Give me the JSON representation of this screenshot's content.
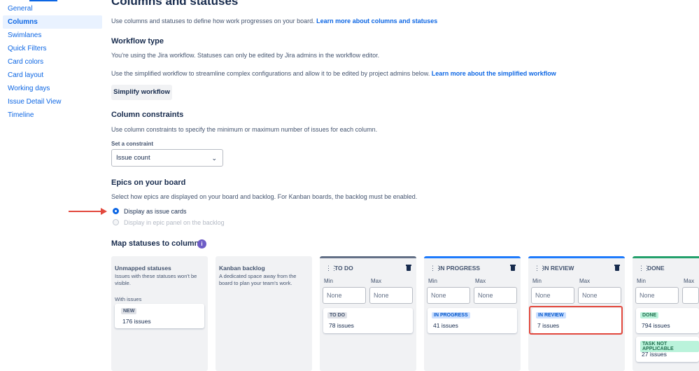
{
  "sidebar": {
    "items": [
      {
        "label": "General"
      },
      {
        "label": "Columns"
      },
      {
        "label": "Swimlanes"
      },
      {
        "label": "Quick Filters"
      },
      {
        "label": "Card colors"
      },
      {
        "label": "Card layout"
      },
      {
        "label": "Working days"
      },
      {
        "label": "Issue Detail View"
      },
      {
        "label": "Timeline"
      }
    ]
  },
  "header": {
    "title": "Columns and statuses",
    "intro": "Use columns and statuses to define how work progresses on your board.",
    "intro_link": "Learn more about columns and statuses"
  },
  "workflow": {
    "title": "Workflow type",
    "text1": "You're using the Jira workflow. Statuses can only be edited by Jira admins in the workflow editor.",
    "text2": "Use the simplified workflow to streamline complex configurations and allow it to be edited by project admins below.",
    "text2_link": "Learn more about the simplified workflow",
    "button": "Simplify workflow"
  },
  "constraints": {
    "title": "Column constraints",
    "text": "Use column constraints to specify the minimum or maximum number of issues for each column.",
    "select_label": "Set a constraint",
    "select_value": "Issue count"
  },
  "epics": {
    "title": "Epics on your board",
    "text": "Select how epics are displayed on your board and backlog. For Kanban boards, the backlog must be enabled.",
    "option1": "Display as issue cards",
    "option2": "Display in epic panel on the backlog"
  },
  "map": {
    "title": "Map statuses to columns",
    "info_icon": "i",
    "unmapped": {
      "title": "Unmapped statuses",
      "desc": "Issues with these statuses won't be visible.",
      "with_issues": "With issues",
      "status": "NEW",
      "count": "176 issues"
    },
    "backlog": {
      "title": "Kanban backlog",
      "desc": "A dedicated space away from the board to plan your team's work."
    },
    "min_label": "Min",
    "max_label": "Max",
    "none": "None",
    "columns": [
      {
        "title": "TO DO",
        "status": "TO DO",
        "count": "78 issues",
        "color": "#626f86"
      },
      {
        "title": "IN PROGRESS",
        "status": "IN PROGRESS",
        "count": "41 issues",
        "color": "#1d7afc"
      },
      {
        "title": "IN REVIEW",
        "status": "IN REVIEW",
        "count": "7 issues",
        "color": "#1d7afc"
      },
      {
        "title": "DONE",
        "status": "DONE",
        "count": "794 issues",
        "status2": "TASK NOT APPLICABLE",
        "count2": "27 issues",
        "color": "#22a06b"
      }
    ]
  },
  "colors": {
    "accent": "#0c66e4",
    "highlight": "#e2483d",
    "done_green": "#22a06b"
  }
}
